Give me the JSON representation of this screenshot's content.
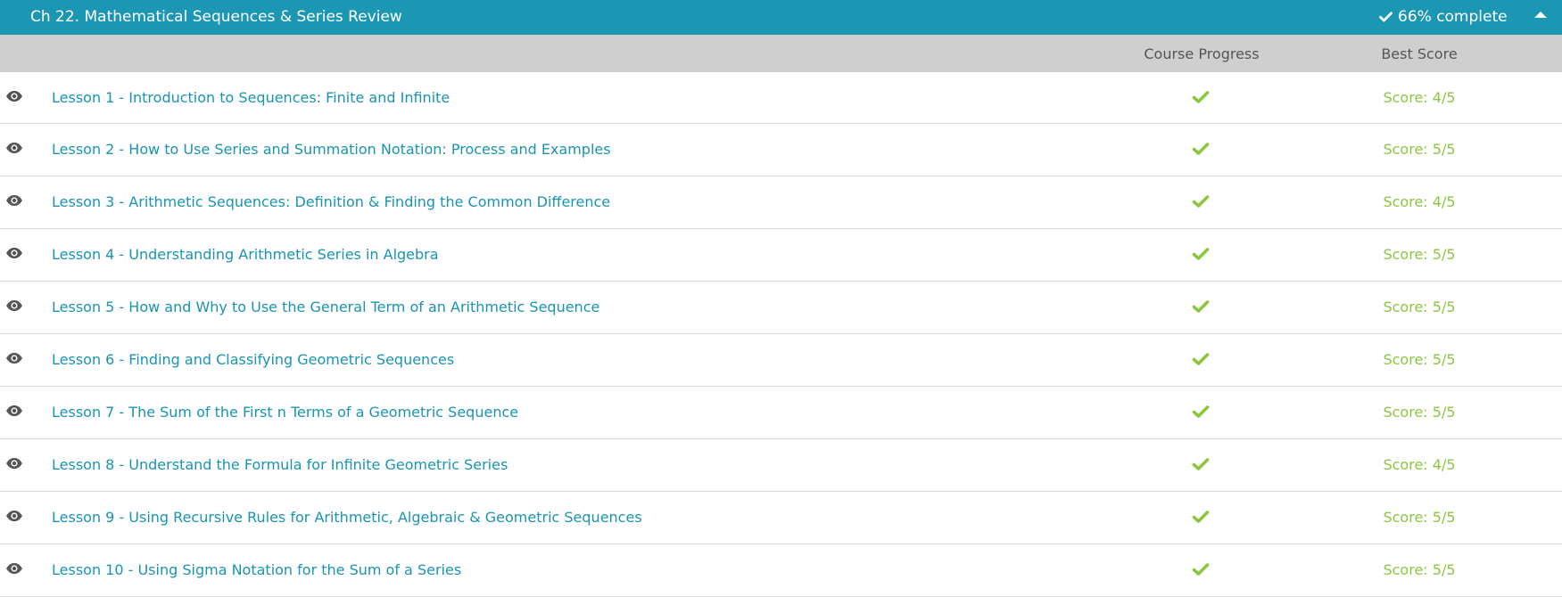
{
  "chapter": {
    "title": "Ch 22. Mathematical Sequences & Series Review",
    "progress_text": "66% complete",
    "progress_icon": "checkmark-icon",
    "toggle_icon": "caret-up-icon"
  },
  "columns": {
    "progress_header": "Course Progress",
    "score_header": "Best Score"
  },
  "colors": {
    "header_bg": "#1b97b3",
    "columns_bg": "#cfcfcf",
    "link": "#1a94b2",
    "success": "#8cc63f"
  },
  "lessons": [
    {
      "title": "Lesson 1 - Introduction to Sequences: Finite and Infinite",
      "completed": true,
      "score": "Score: 4/5"
    },
    {
      "title": "Lesson 2 - How to Use Series and Summation Notation: Process and Examples",
      "completed": true,
      "score": "Score: 5/5"
    },
    {
      "title": "Lesson 3 - Arithmetic Sequences: Definition & Finding the Common Difference",
      "completed": true,
      "score": "Score: 4/5"
    },
    {
      "title": "Lesson 4 - Understanding Arithmetic Series in Algebra",
      "completed": true,
      "score": "Score: 5/5"
    },
    {
      "title": "Lesson 5 - How and Why to Use the General Term of an Arithmetic Sequence",
      "completed": true,
      "score": "Score: 5/5"
    },
    {
      "title": "Lesson 6 - Finding and Classifying Geometric Sequences",
      "completed": true,
      "score": "Score: 5/5"
    },
    {
      "title": "Lesson 7 - The Sum of the First n Terms of a Geometric Sequence",
      "completed": true,
      "score": "Score: 5/5"
    },
    {
      "title": "Lesson 8 - Understand the Formula for Infinite Geometric Series",
      "completed": true,
      "score": "Score: 4/5"
    },
    {
      "title": "Lesson 9 - Using Recursive Rules for Arithmetic, Algebraic & Geometric Sequences",
      "completed": true,
      "score": "Score: 5/5"
    },
    {
      "title": "Lesson 10 - Using Sigma Notation for the Sum of a Series",
      "completed": true,
      "score": "Score: 5/5"
    }
  ]
}
